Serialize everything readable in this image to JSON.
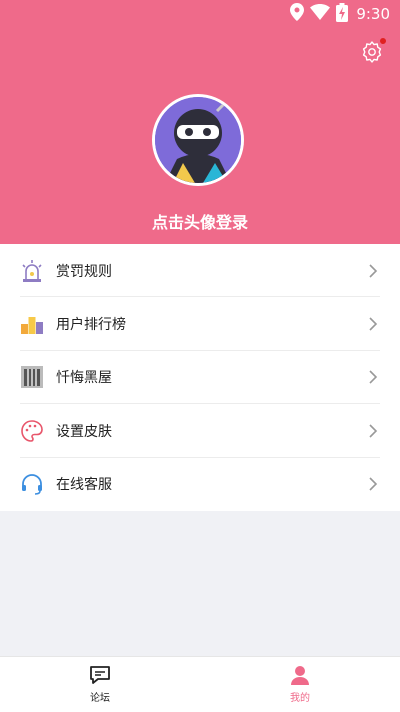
{
  "status_bar": {
    "time": "9:30",
    "icons": [
      "location-icon",
      "wifi-icon",
      "battery-icon"
    ]
  },
  "header": {
    "login_prompt": "点击头像登录",
    "bg_color": "#ef6a8a",
    "settings_icon": "gear-icon"
  },
  "menu": {
    "items": [
      {
        "label": "赏罚规则",
        "icon": "alarm-light-icon"
      },
      {
        "label": "用户排行榜",
        "icon": "leaderboard-icon"
      },
      {
        "label": "忏悔黑屋",
        "icon": "jail-icon"
      },
      {
        "label": "设置皮肤",
        "icon": "palette-icon"
      },
      {
        "label": "在线客服",
        "icon": "headset-icon"
      }
    ]
  },
  "tabbar": {
    "tabs": [
      {
        "label": "论坛",
        "icon": "chat-icon",
        "active": false
      },
      {
        "label": "我的",
        "icon": "person-icon",
        "active": true
      }
    ],
    "active_color": "#ef6a8a"
  }
}
